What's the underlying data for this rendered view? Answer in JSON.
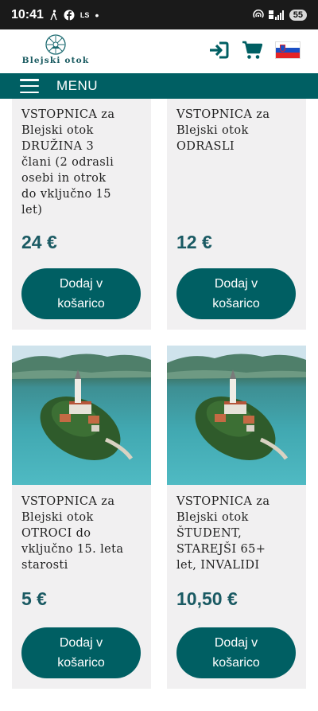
{
  "status_bar": {
    "time": "10:41",
    "left_icons": [
      "walking-icon",
      "facebook-icon",
      "ls-icon",
      "dot-icon"
    ],
    "ls_text": "LS",
    "battery": "55"
  },
  "header": {
    "logo_text": "Blejski otok",
    "icons": [
      "login-icon",
      "cart-icon",
      "slovenia-flag-icon"
    ],
    "colors": {
      "brand": "#005f63",
      "text": "#1f1f1f",
      "price": "#1a5a63",
      "card_bg": "#f1f0f1"
    }
  },
  "menu": {
    "label": "MENU"
  },
  "products": [
    {
      "title_lines": [
        "VSTOPNICA za",
        "Blejski otok",
        "DRUŽINA 3",
        "člani (2 odrasli",
        "osebi in otrok",
        "do vključno 15",
        "let)"
      ],
      "price": "24 €",
      "button_lines": [
        "Dodaj v",
        "košarico"
      ]
    },
    {
      "title_lines": [
        "VSTOPNICA za",
        "Blejski otok",
        "ODRASLI"
      ],
      "price": "12 €",
      "button_lines": [
        "Dodaj v",
        "košarico"
      ]
    },
    {
      "title_lines": [
        "VSTOPNICA za",
        "Blejski otok",
        "OTROCI do",
        "vključno 15. leta",
        "starosti"
      ],
      "price": "5 €",
      "button_lines": [
        "Dodaj v",
        "košarico"
      ]
    },
    {
      "title_lines": [
        "VSTOPNICA za",
        "Blejski otok",
        "ŠTUDENT,",
        "STAREJŠI 65+",
        "let, INVALIDI"
      ],
      "price": "10,50 €",
      "button_lines": [
        "Dodaj v",
        "košarico"
      ]
    }
  ]
}
